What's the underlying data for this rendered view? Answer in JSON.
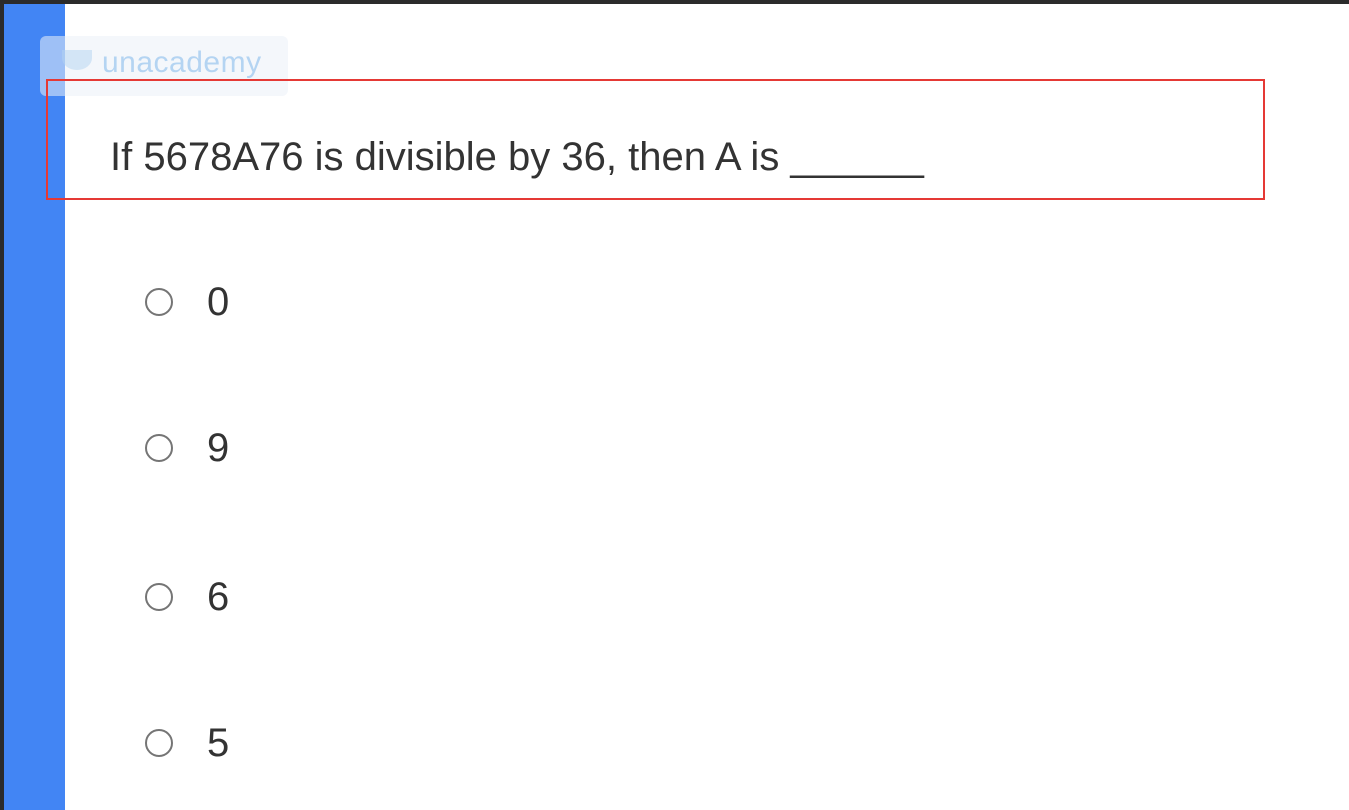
{
  "watermark": {
    "text": "unacademy",
    "logo_icon": "unacademy-logo-icon"
  },
  "question": {
    "text": "If 5678A76 is divisible by 36, then A is ______"
  },
  "options": [
    {
      "label": "0"
    },
    {
      "label": "9"
    },
    {
      "label": "6"
    },
    {
      "label": "5"
    }
  ],
  "colors": {
    "accent_bar": "#4285f4",
    "highlight_border": "#e53935",
    "text": "#333333",
    "radio_border": "#757575"
  }
}
